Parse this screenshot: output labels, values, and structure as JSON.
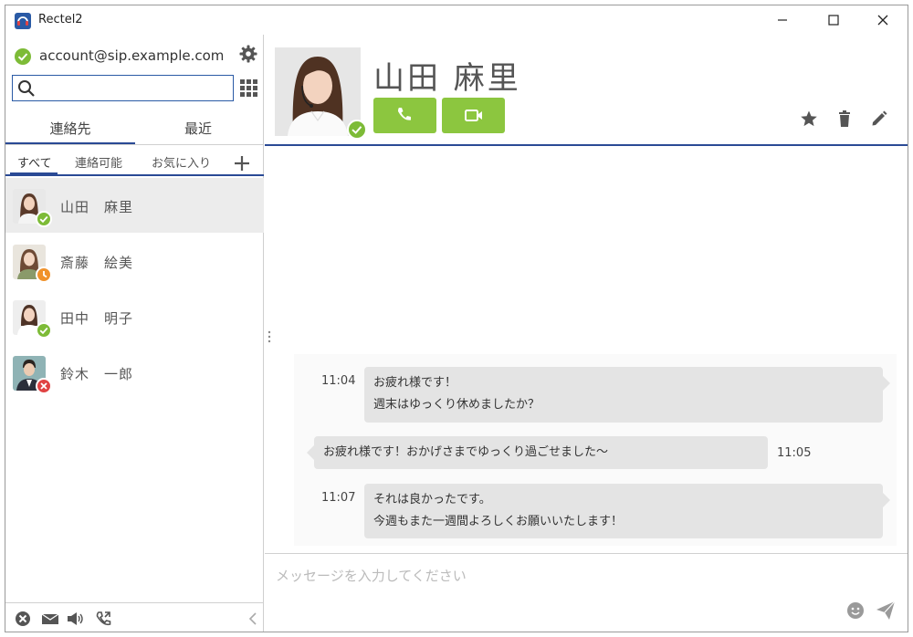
{
  "window": {
    "title": "Rectel2",
    "controls": [
      "minimize-icon",
      "maximize-icon",
      "close-icon"
    ]
  },
  "account": {
    "status": "available",
    "address": "account@sip.example.com"
  },
  "search": {
    "value": "",
    "placeholder": ""
  },
  "tabs": [
    {
      "label": "連絡先",
      "active": true
    },
    {
      "label": "最近",
      "active": false
    }
  ],
  "filters": [
    {
      "label": "すべて",
      "active": true
    },
    {
      "label": "連絡可能",
      "active": false
    },
    {
      "label": "お気に入り",
      "active": false
    }
  ],
  "contacts": [
    {
      "name": "山田　麻里",
      "status": "available",
      "selected": true
    },
    {
      "name": "斎藤　絵美",
      "status": "away",
      "selected": false
    },
    {
      "name": "田中　明子",
      "status": "available",
      "selected": false
    },
    {
      "name": "鈴木　一郎",
      "status": "busy",
      "selected": false
    }
  ],
  "status_colors": {
    "available": "#7dbb37",
    "away": "#f0922b",
    "busy": "#e04343"
  },
  "chat": {
    "contact_name": "山田 麻里",
    "contact_status": "available",
    "actions": [
      "phone-icon",
      "video-icon"
    ],
    "header_icons": [
      "star-icon",
      "trash-icon",
      "pencil-icon"
    ],
    "messages": [
      {
        "time": "11:04",
        "direction": "incoming",
        "lines": [
          "お疲れ様です！",
          "週末はゆっくり休めましたか？"
        ]
      },
      {
        "time": "11:05",
        "direction": "outgoing",
        "lines": [
          "お疲れ様です！おかげさまでゆっくり過ごせました～"
        ]
      },
      {
        "time": "11:07",
        "direction": "incoming",
        "lines": [
          "それは良かったです。",
          "今週もまた一週間よろしくお願いいたします！"
        ]
      }
    ],
    "input_placeholder": "メッセージを入力してください"
  },
  "bottom_bar": [
    "dnd-icon",
    "voicemail-icon",
    "speaker-icon",
    "call-forward-icon",
    "collapse-icon"
  ],
  "accent_color": "#2a4a95",
  "button_color": "#8cc63f"
}
